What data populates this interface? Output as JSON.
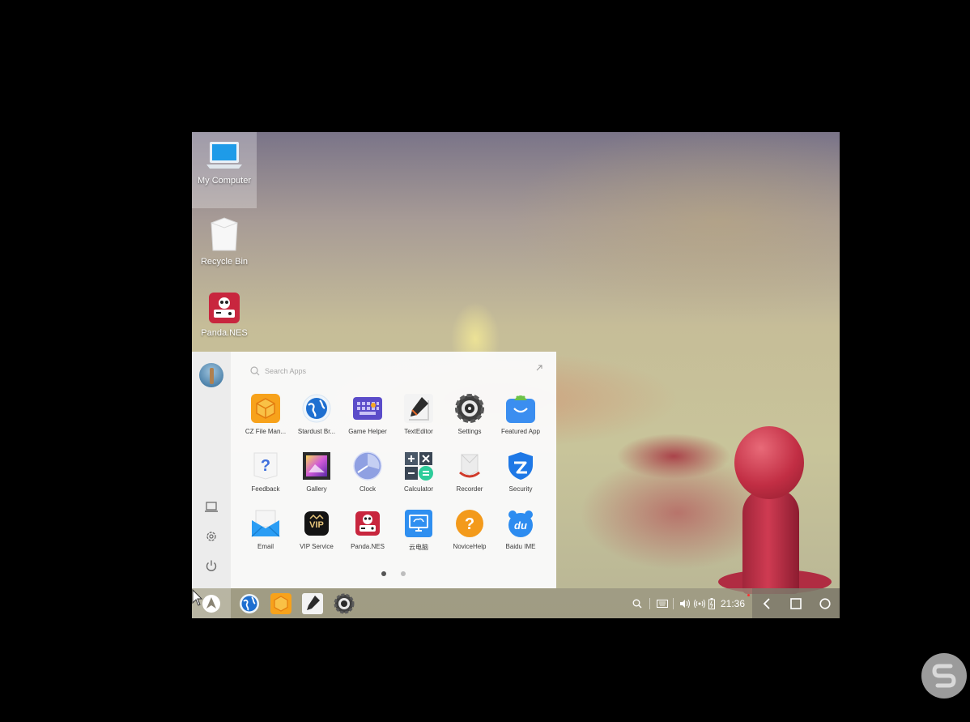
{
  "desktop": {
    "icons": [
      {
        "label": "My Computer",
        "icon": "laptop-icon"
      },
      {
        "label": "Recycle Bin",
        "icon": "trash-icon"
      },
      {
        "label": "Panda.NES",
        "icon": "panda-nes-icon"
      }
    ]
  },
  "start_menu": {
    "search_placeholder": "Search Apps",
    "apps": [
      {
        "label": "CZ File Man...",
        "icon": "file-manager-icon",
        "color": "#f5a623"
      },
      {
        "label": "Stardust Br...",
        "icon": "globe-icon",
        "color": "#1e6fd0"
      },
      {
        "label": "Game Helper",
        "icon": "keyboard-icon",
        "color": "#5b4cc9"
      },
      {
        "label": "TextEditor",
        "icon": "pen-icon",
        "color": "#e8e8e8"
      },
      {
        "label": "Settings",
        "icon": "gear-icon",
        "color": "#444444"
      },
      {
        "label": "Featured App",
        "icon": "store-icon",
        "color": "#3b8ef0"
      },
      {
        "label": "Feedback",
        "icon": "question-doc-icon",
        "color": "#5b7ee0"
      },
      {
        "label": "Gallery",
        "icon": "picture-icon",
        "color": "#9b3cc5"
      },
      {
        "label": "Clock",
        "icon": "clock-icon",
        "color": "#7b8fd8"
      },
      {
        "label": "Calculator",
        "icon": "calculator-icon",
        "color": "#3a4a5a"
      },
      {
        "label": "Recorder",
        "icon": "recorder-icon",
        "color": "#d03a2a"
      },
      {
        "label": "Security",
        "icon": "shield-icon",
        "color": "#1e78e6"
      },
      {
        "label": "Email",
        "icon": "envelope-icon",
        "color": "#2a9df4"
      },
      {
        "label": "VIP Service",
        "icon": "vip-icon",
        "color": "#111111"
      },
      {
        "label": "Panda.NES",
        "icon": "panda-nes-icon",
        "color": "#c8263e"
      },
      {
        "label": "云电脑",
        "icon": "cloud-pc-icon",
        "color": "#2f8ff0"
      },
      {
        "label": "NoviceHelp",
        "icon": "help-icon",
        "color": "#f39a1b"
      },
      {
        "label": "Baidu IME",
        "icon": "baidu-icon",
        "color": "#2d8cf0"
      }
    ],
    "page_count": 2,
    "current_page": 1
  },
  "taskbar": {
    "pinned": [
      "globe-icon",
      "file-manager-icon",
      "pen-icon",
      "gear-icon"
    ],
    "clock": "21:36",
    "tray": [
      "search-icon",
      "keyboard-icon",
      "volume-icon",
      "network-icon",
      "battery-icon"
    ]
  },
  "navbar": [
    "back-icon",
    "recents-icon",
    "home-icon"
  ]
}
